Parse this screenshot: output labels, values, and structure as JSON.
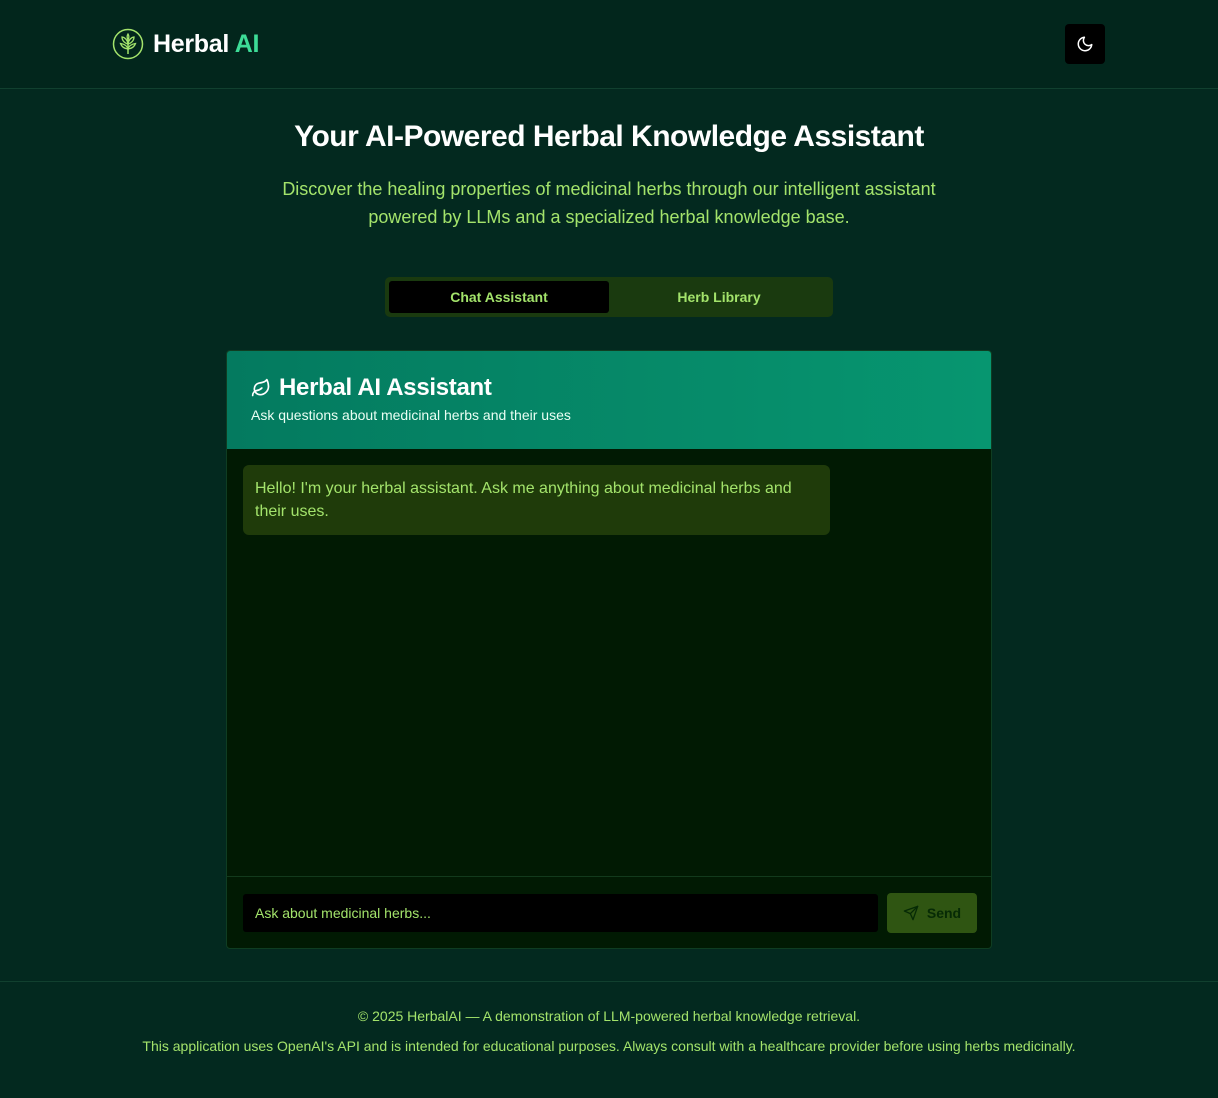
{
  "header": {
    "brand_main": "Herbal",
    "brand_accent": "AI",
    "theme_icon": "moon-icon",
    "logo_icon": "tree-leaf-icon"
  },
  "hero": {
    "title": "Your AI-Powered Herbal Knowledge Assistant",
    "subtitle": "Discover the healing properties of medicinal herbs through our intelligent assistant powered by LLMs and a specialized herbal knowledge base."
  },
  "tabs": [
    {
      "label": "Chat Assistant",
      "active": true
    },
    {
      "label": "Herb Library",
      "active": false
    }
  ],
  "chat": {
    "title": "Herbal AI Assistant",
    "subtitle": "Ask questions about medicinal herbs and their uses",
    "title_icon": "leaf-icon",
    "messages": [
      {
        "role": "assistant",
        "text": "Hello! I'm your herbal assistant. Ask me anything about medicinal herbs and their uses."
      }
    ],
    "input_placeholder": "Ask about medicinal herbs...",
    "input_value": "",
    "send_label": "Send",
    "send_icon": "send-icon"
  },
  "footer": {
    "copyright": "© 2025 HerbalAI — A demonstration of LLM-powered herbal knowledge retrieval.",
    "disclaimer": "This application uses OpenAI's API and is intended for educational purposes. Always consult with a healthcare provider before using herbs medicinally."
  },
  "colors": {
    "background": "#03291f",
    "accent_text": "#a3e36b",
    "brand_accent": "#3ddc97",
    "card_header": "#079670"
  }
}
